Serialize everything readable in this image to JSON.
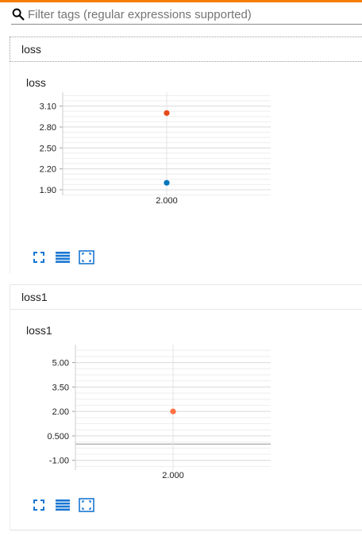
{
  "colors": {
    "accent": "#f57c00",
    "run_a": "#e64a19",
    "run_b": "#0277bd",
    "run_c": "#ff7043",
    "icon": "#1976d2"
  },
  "search": {
    "placeholder": "Filter tags (regular expressions supported)",
    "icon": "search-icon"
  },
  "categories": [
    {
      "name": "loss",
      "cards": [
        {
          "title": "loss",
          "actions": [
            "expand-icon",
            "toggle-log-scale-icon",
            "fit-domain-icon"
          ]
        }
      ]
    },
    {
      "name": "loss1",
      "cards": [
        {
          "title": "loss1",
          "actions": [
            "expand-icon",
            "toggle-log-scale-icon",
            "fit-domain-icon"
          ]
        }
      ]
    }
  ],
  "chart_data": [
    {
      "type": "scatter",
      "title": "loss",
      "xlabel": "",
      "ylabel": "",
      "x_ticks": [
        "2.000"
      ],
      "y_ticks": [
        "3.10",
        "2.80",
        "2.50",
        "2.20",
        "1.90"
      ],
      "ylim": [
        1.82,
        3.3
      ],
      "grid": true,
      "series": [
        {
          "color": "#e64a19",
          "points": [
            {
              "x": 2.0,
              "y": 3.0
            }
          ]
        },
        {
          "color": "#0277bd",
          "points": [
            {
              "x": 2.0,
              "y": 2.0
            }
          ]
        }
      ]
    },
    {
      "type": "scatter",
      "title": "loss1",
      "xlabel": "",
      "ylabel": "",
      "x_ticks": [
        "2.000"
      ],
      "y_ticks": [
        "5.00",
        "3.50",
        "2.00",
        "0.500",
        "-1.00"
      ],
      "ylim": [
        -1.6,
        6.1
      ],
      "grid": true,
      "series": [
        {
          "color": "#ff7043",
          "points": [
            {
              "x": 2.0,
              "y": 2.0
            }
          ]
        }
      ]
    }
  ]
}
